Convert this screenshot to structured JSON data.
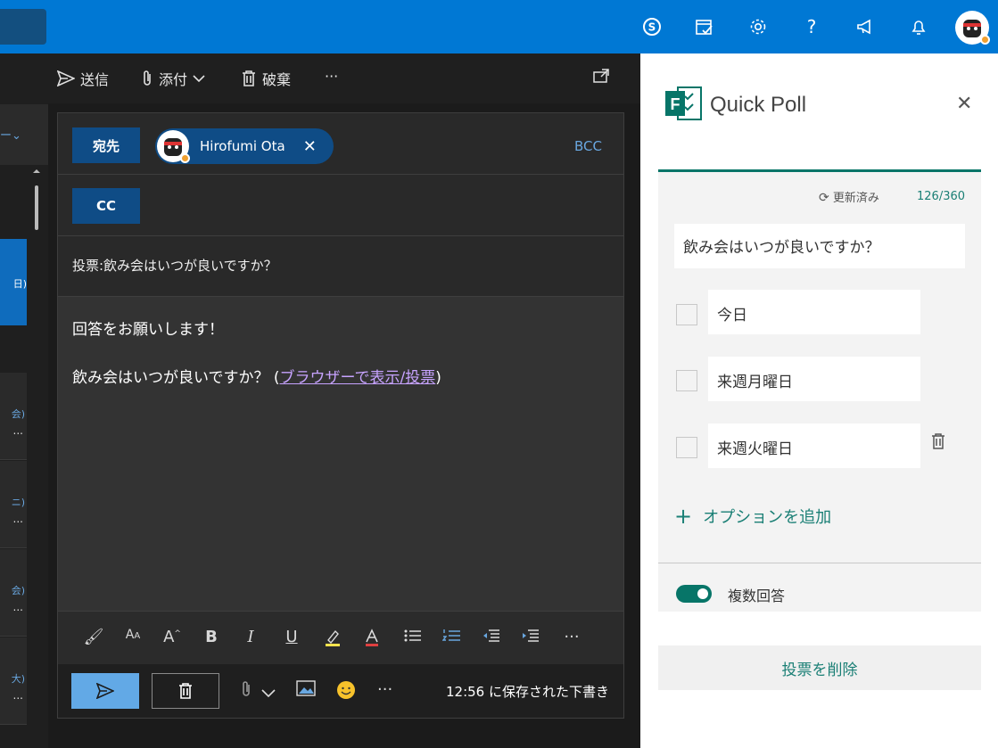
{
  "topbar": {
    "icons": [
      "skype-icon",
      "calendar-check-icon",
      "gear-icon",
      "help-icon",
      "megaphone-icon",
      "bell-icon"
    ],
    "help_glyph": "?"
  },
  "left_list": {
    "items": [
      {
        "t1": "会)",
        "t2": "..."
      },
      {
        "t1": "ニ)",
        "t2": "..."
      },
      {
        "t1": "会)",
        "t2": "..."
      },
      {
        "t1": "大)",
        "t2": "..."
      }
    ],
    "selected_fragment": "日)"
  },
  "toolbar": {
    "send_label": "送信",
    "attach_label": "添付",
    "discard_label": "破棄",
    "more_label": "···"
  },
  "compose": {
    "to_label": "宛先",
    "cc_label": "CC",
    "bcc_label": "BCC",
    "recipient_name": "Hirofumi Ota",
    "subject": "投票:飲み会はいつが良いですか？",
    "body_line1": "回答をお願いします！",
    "body_line2_prefix": "飲み会はいつが良いですか？ (",
    "body_link": "ブラウザーで表示/投票",
    "body_line2_suffix": ")",
    "draft_status": "12:56 に保存された下書き"
  },
  "quick_poll": {
    "title": "Quick Poll",
    "updated_label": "更新済み",
    "char_count": "126/360",
    "question": "飲み会はいつが良いですか？",
    "options": [
      "今日",
      "来週月曜日",
      "来週火曜日"
    ],
    "add_option_label": "オプションを追加",
    "multiple_answers_label": "複数回答",
    "multiple_answers_on": true,
    "delete_poll_label": "投票を削除",
    "accent_color": "#077568"
  }
}
